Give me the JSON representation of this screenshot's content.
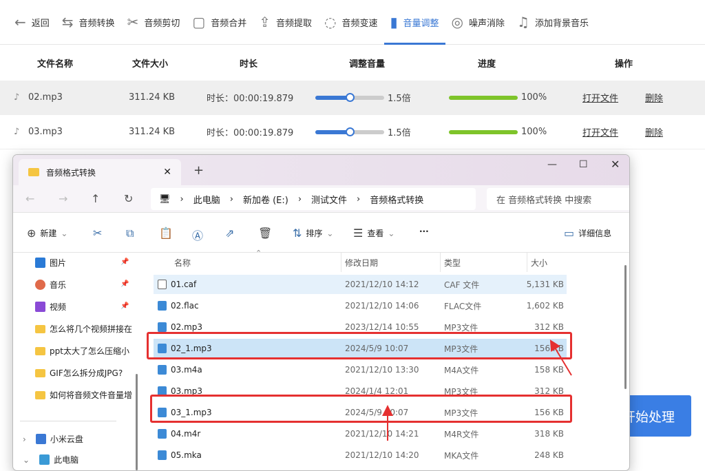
{
  "toolbar": {
    "back": "返回",
    "items": [
      {
        "label": "音频转换",
        "icon": "convert-icon",
        "glyph": "⇆"
      },
      {
        "label": "音频剪切",
        "icon": "scissors-icon",
        "glyph": "✂"
      },
      {
        "label": "音频合并",
        "icon": "merge-icon",
        "glyph": "▢"
      },
      {
        "label": "音频提取",
        "icon": "upload-icon",
        "glyph": "⇪"
      },
      {
        "label": "音频变速",
        "icon": "speed-icon",
        "glyph": "◌"
      },
      {
        "label": "音量调整",
        "icon": "volume-bars-icon",
        "glyph": "▮"
      },
      {
        "label": "噪声消除",
        "icon": "noise-icon",
        "glyph": "◎"
      },
      {
        "label": "添加背景音乐",
        "icon": "music-icon",
        "glyph": "♫"
      }
    ],
    "active": "音量调整"
  },
  "table": {
    "headers": [
      "文件名称",
      "文件大小",
      "时长",
      "调整音量",
      "进度",
      "操作"
    ],
    "rows": [
      {
        "name": "02.mp3",
        "size": "311.24 KB",
        "duration": "时长：00:00:19.879",
        "volume": "1.5倍",
        "volume_value": 1.5,
        "progress": "100%",
        "progress_value": 100,
        "open": "打开文件",
        "delete": "删除"
      },
      {
        "name": "03.mp3",
        "size": "311.24 KB",
        "duration": "时长：00:00:19.879",
        "volume": "1.5倍",
        "volume_value": 1.5,
        "progress": "100%",
        "progress_value": 100,
        "open": "打开文件",
        "delete": "删除"
      }
    ]
  },
  "start_button": "开始处理",
  "explorer": {
    "tab_title": "音频格式转换",
    "breadcrumb": [
      "此电脑",
      "新加卷 (E:)",
      "测试文件",
      "音频格式转换"
    ],
    "search_placeholder": "在 音频格式转换 中搜索",
    "commands": {
      "new": "新建",
      "sort": "排序",
      "view": "查看",
      "more": "···",
      "details": "详细信息"
    },
    "sidebar": [
      "图片",
      "音乐",
      "视频",
      "怎么将几个视频拼接在",
      "ppt太大了怎么压缩小",
      "GIF怎么拆分成JPG?",
      "如何将音频文件音量增",
      "小米云盘",
      "此电脑"
    ],
    "columns": [
      "名称",
      "修改日期",
      "类型",
      "大小"
    ],
    "files": [
      {
        "name": "01.caf",
        "date": "2021/12/10 14:12",
        "type": "CAF 文件",
        "size": "5,131 KB"
      },
      {
        "name": "02.flac",
        "date": "2021/12/10 14:06",
        "type": "FLAC文件",
        "size": "1,602 KB"
      },
      {
        "name": "02.mp3",
        "date": "2023/12/14 10:55",
        "type": "MP3文件",
        "size": "312 KB"
      },
      {
        "name": "02_1.mp3",
        "date": "2024/5/9 10:07",
        "type": "MP3文件",
        "size": "156 KB"
      },
      {
        "name": "03.m4a",
        "date": "2021/12/10 13:30",
        "type": "M4A文件",
        "size": "158 KB"
      },
      {
        "name": "03.mp3",
        "date": "2024/1/4 12:01",
        "type": "MP3文件",
        "size": "312 KB"
      },
      {
        "name": "03_1.mp3",
        "date": "2024/5/9 10:07",
        "type": "MP3文件",
        "size": "156 KB"
      },
      {
        "name": "04.m4r",
        "date": "2021/12/10 14:21",
        "type": "M4R文件",
        "size": "318 KB"
      },
      {
        "name": "05.mka",
        "date": "2021/12/10 14:20",
        "type": "MKA文件",
        "size": "248 KB"
      }
    ]
  },
  "colors": {
    "accent": "#3a78d4",
    "progress": "#7ec42a",
    "highlight": "#e53030"
  }
}
